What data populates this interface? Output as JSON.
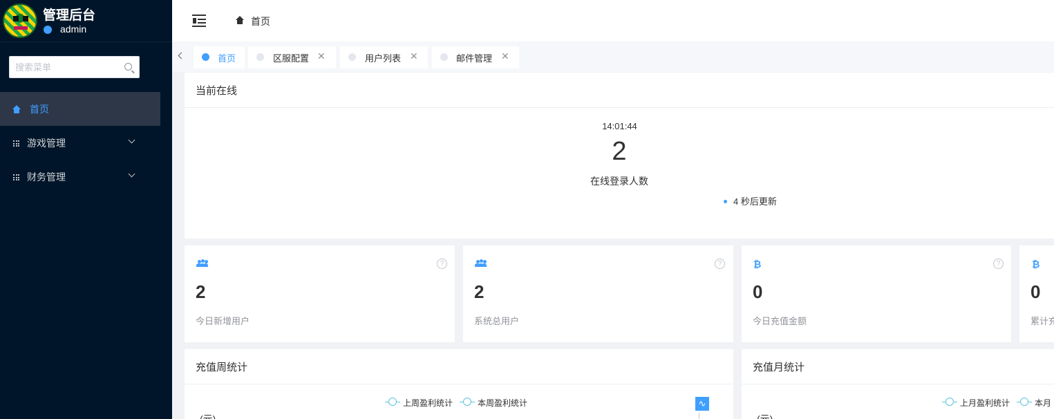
{
  "brand": {
    "title": "管理后台",
    "user": "admin"
  },
  "sidebar": {
    "search_placeholder": "搜索菜单",
    "items": [
      {
        "label": "首页",
        "icon": "home-icon",
        "active": true
      },
      {
        "label": "游戏管理",
        "icon": "grid-icon",
        "expandable": true
      },
      {
        "label": "财务管理",
        "icon": "grid-icon",
        "expandable": true
      }
    ]
  },
  "header": {
    "breadcrumb": "首页"
  },
  "tabs": [
    {
      "label": "首页",
      "active": true,
      "closable": false
    },
    {
      "label": "区服配置",
      "active": false,
      "closable": true
    },
    {
      "label": "用户列表",
      "active": false,
      "closable": true
    },
    {
      "label": "邮件管理",
      "active": false,
      "closable": true
    }
  ],
  "online": {
    "title": "当前在线",
    "time": "14:01:44",
    "count": "2",
    "label": "在线登录人数",
    "refresh": "4 秒后更新"
  },
  "stats": [
    {
      "icon": "users-icon",
      "value": "2",
      "label": "今日新增用户"
    },
    {
      "icon": "users-icon",
      "value": "2",
      "label": "系统总用户"
    },
    {
      "icon": "bitcoin-icon",
      "value": "0",
      "label": "今日充值金额"
    },
    {
      "icon": "bitcoin-icon",
      "value": "0",
      "label": "累计充"
    }
  ],
  "weekly": {
    "title": "充值周统计",
    "legend": [
      "上周盈利统计",
      "本周盈利统计"
    ],
    "yunit": "(元)"
  },
  "monthly": {
    "title": "充值月统计",
    "legend": [
      "上月盈利统计",
      "本月"
    ],
    "yunit": "(元)"
  },
  "colors": {
    "sidebar_bg": "#001529",
    "accent": "#409eff",
    "active_menu_bg": "#2d3748",
    "legend_line": "#5cc4de"
  }
}
